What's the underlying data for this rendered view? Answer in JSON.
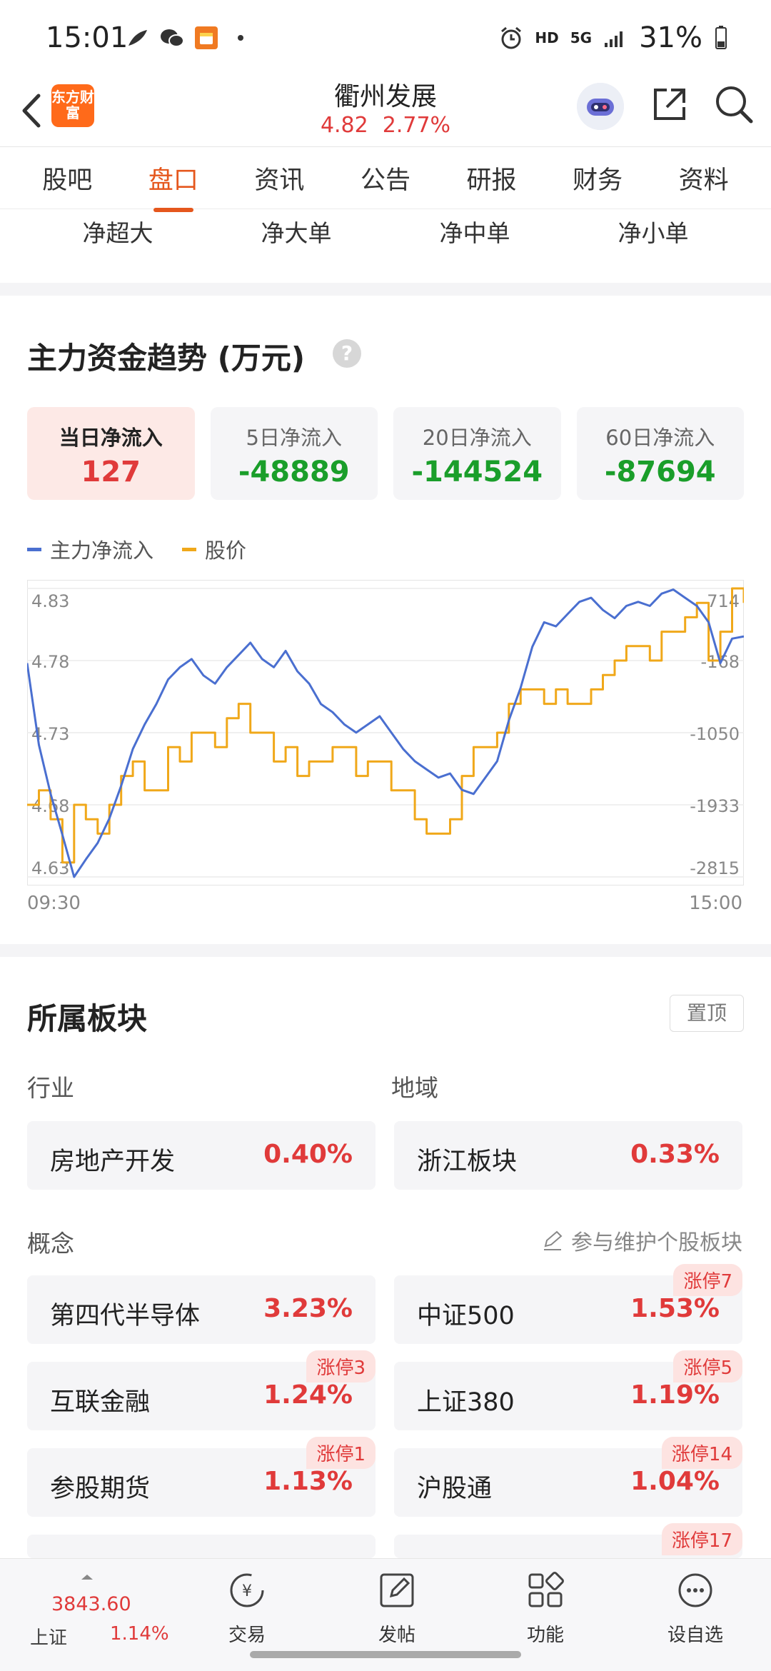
{
  "status_bar": {
    "time": "15:01",
    "battery": "31%",
    "network": "HD",
    "network_gen": "5G",
    "icons_left": [
      "feather-icon",
      "wechat-icon",
      "red-envelope-icon",
      "dot-icon"
    ],
    "icons_right": [
      "alarm-icon",
      "signal-icon",
      "battery-icon"
    ]
  },
  "header": {
    "app_logo_text": "东方财富",
    "stock_name": "衢州发展",
    "price": "4.82",
    "change_pct": "2.77%"
  },
  "tabs": [
    "股吧",
    "盘口",
    "资讯",
    "公告",
    "研报",
    "财务",
    "资料"
  ],
  "active_tab": "盘口",
  "sub_tabs": [
    "净超大",
    "净大单",
    "净中单",
    "净小单"
  ],
  "fund_trend": {
    "title": "主力资金趋势 (万元)",
    "help": "?",
    "cards": [
      {
        "label": "当日净流入",
        "value": "127",
        "sign": "pos"
      },
      {
        "label": "5日净流入",
        "value": "-48889",
        "sign": "neg"
      },
      {
        "label": "20日净流入",
        "value": "-144524",
        "sign": "neg"
      },
      {
        "label": "60日净流入",
        "value": "-87694",
        "sign": "neg"
      }
    ],
    "legend": [
      {
        "name": "主力净流入",
        "color": "#4a6fd0"
      },
      {
        "name": "股价",
        "color": "#f0a81a"
      }
    ],
    "time_start": "09:30",
    "time_end": "15:00"
  },
  "chart_data": {
    "type": "line",
    "left_axis_ticks": [
      "4.83",
      "4.78",
      "4.73",
      "4.68",
      "4.63"
    ],
    "right_axis_ticks": [
      "714",
      "-168",
      "-1050",
      "-1933",
      "-2815"
    ],
    "ylim_price": [
      4.63,
      4.83
    ],
    "ylim_flow": [
      -2815,
      714
    ],
    "x_range": [
      "09:30",
      "15:00"
    ],
    "series": [
      {
        "name": "主力净流入",
        "color": "#4a6fd0",
        "values": [
          -200,
          -1200,
          -1800,
          -2300,
          -2815,
          -2600,
          -2400,
          -2100,
          -1700,
          -1250,
          -950,
          -700,
          -400,
          -250,
          -150,
          -350,
          -450,
          -250,
          -100,
          50,
          -150,
          -250,
          -50,
          -300,
          -450,
          -700,
          -800,
          -950,
          -1050,
          -950,
          -850,
          -1050,
          -1250,
          -1400,
          -1500,
          -1600,
          -1550,
          -1750,
          -1800,
          -1600,
          -1400,
          -900,
          -500,
          0,
          300,
          250,
          400,
          550,
          600,
          450,
          350,
          500,
          550,
          500,
          650,
          700,
          600,
          500,
          300,
          -200,
          100,
          127
        ]
      },
      {
        "name": "股价",
        "color": "#f0a81a",
        "values": [
          4.68,
          4.69,
          4.67,
          4.64,
          4.68,
          4.67,
          4.66,
          4.68,
          4.7,
          4.71,
          4.69,
          4.69,
          4.72,
          4.71,
          4.73,
          4.73,
          4.72,
          4.74,
          4.75,
          4.73,
          4.73,
          4.71,
          4.72,
          4.7,
          4.71,
          4.71,
          4.72,
          4.72,
          4.7,
          4.71,
          4.71,
          4.69,
          4.69,
          4.67,
          4.66,
          4.66,
          4.67,
          4.7,
          4.72,
          4.72,
          4.73,
          4.75,
          4.76,
          4.76,
          4.75,
          4.76,
          4.75,
          4.75,
          4.76,
          4.77,
          4.78,
          4.79,
          4.79,
          4.78,
          4.8,
          4.8,
          4.81,
          4.82,
          4.78,
          4.8,
          4.83,
          4.82
        ]
      }
    ],
    "grid": true,
    "legend_position": "top-left"
  },
  "sectors": {
    "title": "所属板块",
    "pin_label": "置顶",
    "industry_label": "行业",
    "region_label": "地域",
    "concept_label": "概念",
    "maintain_label": "参与维护个股板块",
    "industry": {
      "name": "房地产开发",
      "pct": "0.40%"
    },
    "region": {
      "name": "浙江板块",
      "pct": "0.33%"
    },
    "concepts": [
      {
        "name": "第四代半导体",
        "pct": "3.23%",
        "badge": ""
      },
      {
        "name": "中证500",
        "pct": "1.53%",
        "badge": "涨停7"
      },
      {
        "name": "互联金融",
        "pct": "1.24%",
        "badge": "涨停3"
      },
      {
        "name": "上证380",
        "pct": "1.19%",
        "badge": "涨停5"
      },
      {
        "name": "参股期货",
        "pct": "1.13%",
        "badge": "涨停1"
      },
      {
        "name": "沪股通",
        "pct": "1.04%",
        "badge": "涨停14"
      },
      {
        "name": "",
        "pct": "",
        "badge": ""
      },
      {
        "name": "",
        "pct": "",
        "badge": "涨停17"
      }
    ]
  },
  "bottom_nav": {
    "index_value": "3843.60",
    "index_name": "上证",
    "index_change": "1.14%",
    "items": [
      {
        "label": "交易",
        "icon": "trade-icon"
      },
      {
        "label": "发帖",
        "icon": "compose-icon"
      },
      {
        "label": "功能",
        "icon": "grid-icon"
      },
      {
        "label": "设自选",
        "icon": "more-icon"
      }
    ]
  }
}
